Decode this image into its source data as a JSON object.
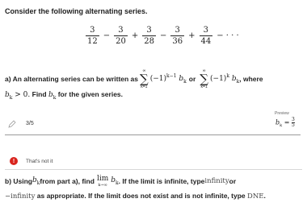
{
  "question": {
    "intro": "Consider the following alternating series.",
    "series_terms": [
      {
        "num": "3",
        "den": "12",
        "op": "−"
      },
      {
        "num": "3",
        "den": "20",
        "op": "+"
      },
      {
        "num": "3",
        "den": "28",
        "op": "−"
      },
      {
        "num": "3",
        "den": "36",
        "op": "+"
      },
      {
        "num": "3",
        "den": "44",
        "op": "− · · ·"
      }
    ]
  },
  "part_a": {
    "prefix": "a) An alternating series can be written as",
    "sum_top": "∞",
    "sum_bottom": "k=1",
    "form1": "(−1)",
    "form1_exp": "k−1",
    "form1_b": "b",
    "form1_b_sub": "k",
    "or_text": "or",
    "form2": "(−1)",
    "form2_exp": "k",
    "form2_b": "b",
    "form2_b_sub": "k",
    "where_text": ", where",
    "line2_b": "b",
    "line2_sub": "k",
    "line2_cond": " > 0.",
    "line2_text": " Find ",
    "line2_b2": "b",
    "line2_sub2": "k",
    "line2_end": " for the given series.",
    "answer_value": "3/5",
    "preview_label": "Preview",
    "preview_value": "b",
    "preview_sub": "k",
    "preview_eq": " = ",
    "preview_num": "3",
    "preview_den": "5"
  },
  "feedback": {
    "icon_glyph": "!",
    "message": "That's not it"
  },
  "part_b": {
    "prefix": "b) Using ",
    "b": "b",
    "b_sub": "k",
    "mid": " from part a), find",
    "lim_word": "lim",
    "lim_sub": "k→∞",
    "lim_b": "b",
    "lim_b_sub": "k",
    "after": ". If the limit is infinite, type ",
    "infinity_word": "infinity",
    "or_text": " or",
    "line2_neg_infinity": "−infinity",
    "line2_text": " as appropriate. If the limit does not exist and is not infinite, type ",
    "dne": "DNE",
    "end": "."
  }
}
